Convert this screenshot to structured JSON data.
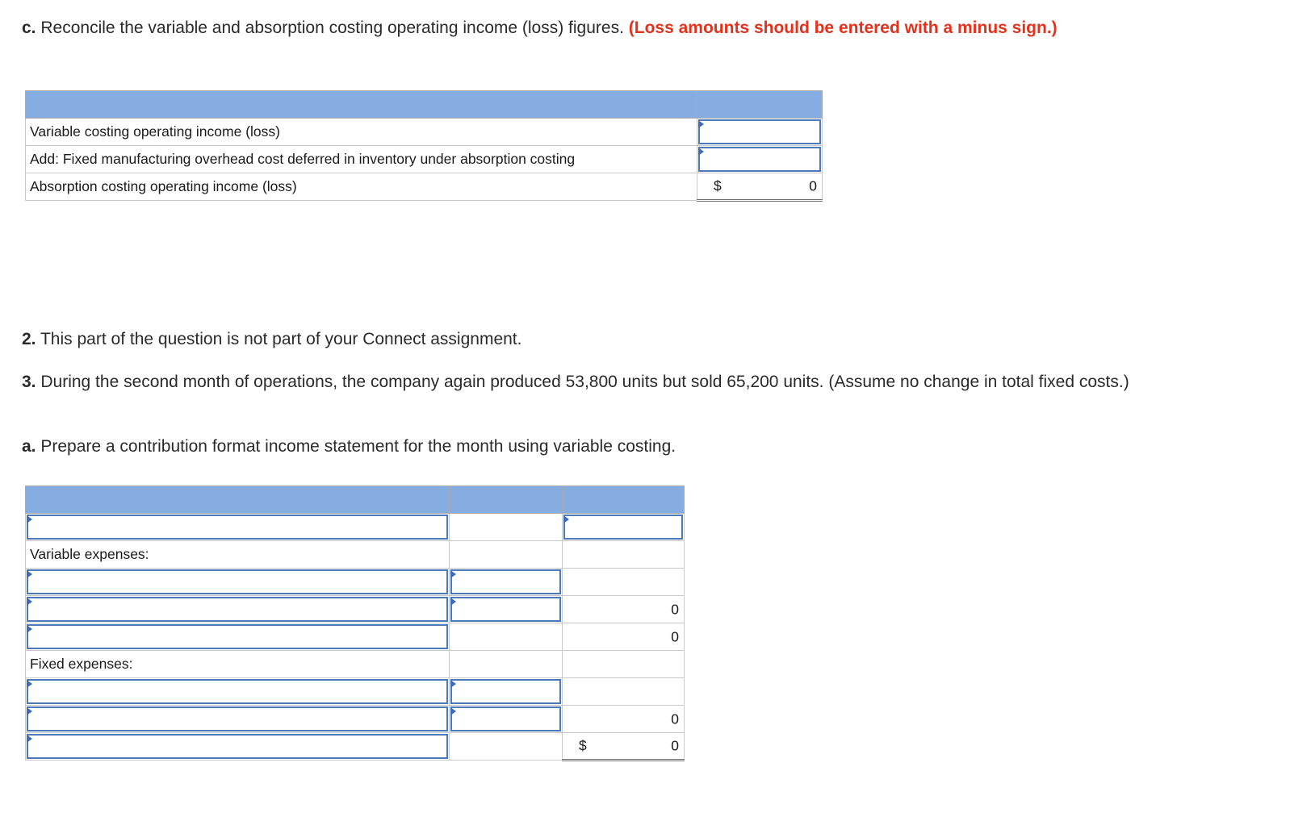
{
  "part_c": {
    "prefix": "c.",
    "text": "Reconcile the variable and absorption costing operating income (loss) figures.",
    "note": "(Loss amounts should be entered with a minus sign.)",
    "rows": [
      {
        "label": "Variable costing operating income (loss)"
      },
      {
        "label": "Add: Fixed manufacturing overhead cost deferred in inventory under absorption costing"
      },
      {
        "label": "Absorption costing operating income (loss)",
        "currency": "$",
        "value": "0"
      }
    ]
  },
  "question_2": {
    "prefix": "2.",
    "text": "This part of the question is not part of your Connect assignment."
  },
  "question_3": {
    "prefix": "3.",
    "text": "During the second month of operations, the company again produced 53,800 units but sold 65,200 units. (Assume no change in total fixed costs.)"
  },
  "part_a": {
    "prefix": "a.",
    "text": "Prepare a contribution format income statement for the month using variable costing.",
    "variable_expenses_label": "Variable expenses:",
    "fixed_expenses_label": "Fixed expenses:",
    "totals": {
      "variable_subtotal": "0",
      "contribution_margin": "0",
      "fixed_subtotal": "0",
      "net_currency": "$",
      "net_operating_income": "0"
    }
  }
}
